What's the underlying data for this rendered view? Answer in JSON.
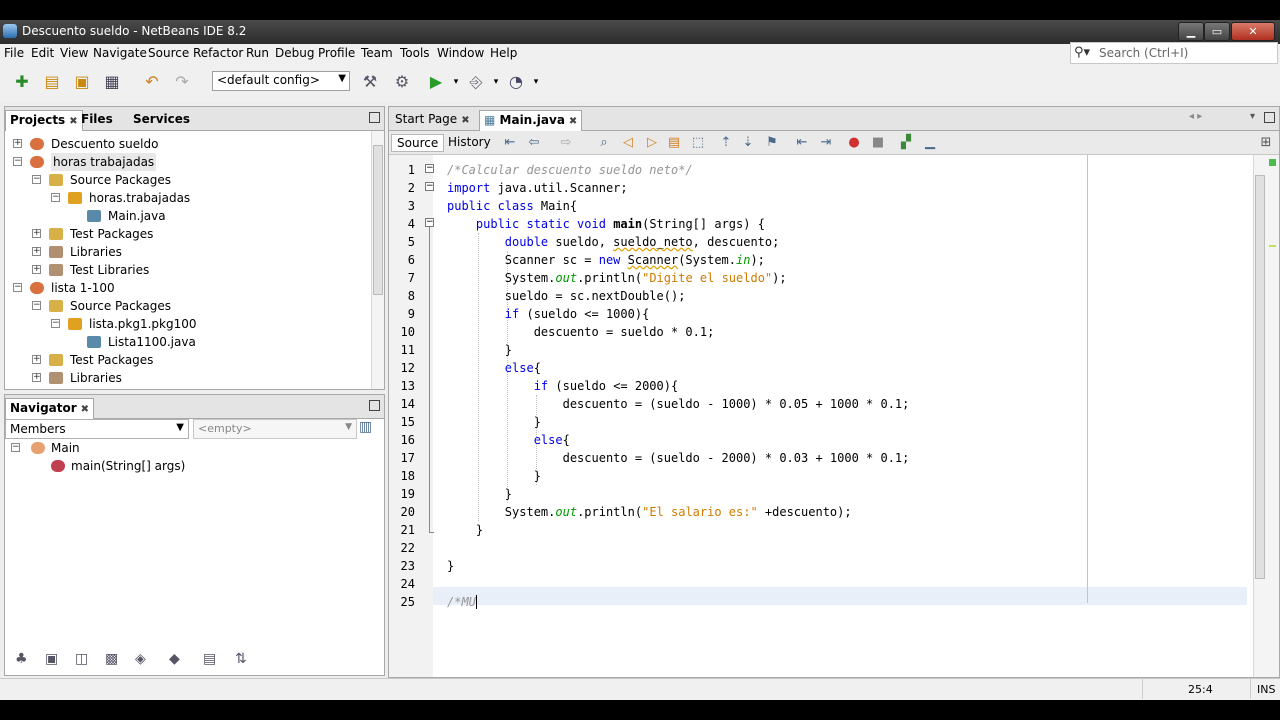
{
  "window": {
    "title": "Descuento sueldo - NetBeans IDE 8.2",
    "buttons": {
      "minimize": "▁",
      "maximize": "▭",
      "close": "✕"
    }
  },
  "menu": [
    "File",
    "Edit",
    "View",
    "Navigate",
    "Source",
    "Refactor",
    "Run",
    "Debug",
    "Profile",
    "Team",
    "Tools",
    "Window",
    "Help"
  ],
  "search": {
    "placeholder": "Search (Ctrl+I)",
    "icon": "search-icon"
  },
  "toolbar": {
    "config": "<default config>",
    "icons": [
      "new-project-icon",
      "new-file-icon",
      "open-project-icon",
      "save-all-icon",
      "undo-icon",
      "redo-icon",
      "clean-build-icon",
      "build-icon",
      "run-icon",
      "debug-icon",
      "profile-icon"
    ]
  },
  "projects_panel": {
    "tabs": [
      "Projects",
      "Files",
      "Services"
    ],
    "close_glyph": "✖",
    "tree": [
      {
        "label": "Descuento sueldo",
        "level": 0,
        "toggle": "+",
        "icon": "project"
      },
      {
        "label": "horas trabajadas",
        "level": 0,
        "toggle": "−",
        "icon": "project",
        "selected": true
      },
      {
        "label": "Source Packages",
        "level": 1,
        "toggle": "−",
        "icon": "package-folder"
      },
      {
        "label": "horas.trabajadas",
        "level": 2,
        "toggle": "−",
        "icon": "package"
      },
      {
        "label": "Main.java",
        "level": 3,
        "toggle": "",
        "icon": "java-file"
      },
      {
        "label": "Test Packages",
        "level": 1,
        "toggle": "+",
        "icon": "package-folder"
      },
      {
        "label": "Libraries",
        "level": 1,
        "toggle": "+",
        "icon": "library"
      },
      {
        "label": "Test Libraries",
        "level": 1,
        "toggle": "+",
        "icon": "library"
      },
      {
        "label": "lista 1-100",
        "level": 0,
        "toggle": "−",
        "icon": "project"
      },
      {
        "label": "Source Packages",
        "level": 1,
        "toggle": "−",
        "icon": "package-folder"
      },
      {
        "label": "lista.pkg1.pkg100",
        "level": 2,
        "toggle": "−",
        "icon": "package"
      },
      {
        "label": "Lista1100.java",
        "level": 3,
        "toggle": "",
        "icon": "java-file"
      },
      {
        "label": "Test Packages",
        "level": 1,
        "toggle": "+",
        "icon": "package-folder"
      },
      {
        "label": "Libraries",
        "level": 1,
        "toggle": "+",
        "icon": "library"
      },
      {
        "label": "Test Libraries",
        "level": 1,
        "toggle": "+",
        "icon": "library"
      }
    ]
  },
  "navigator": {
    "title": "Navigator",
    "members_select": "Members",
    "filter_select": "<empty>",
    "tree": [
      {
        "label": "Main",
        "level": 0,
        "toggle": "−"
      },
      {
        "label": "main(String[] args)",
        "level": 1,
        "toggle": ""
      }
    ]
  },
  "editor": {
    "tabs": [
      {
        "label": "Start Page"
      },
      {
        "label": "Main.java",
        "active": true
      }
    ],
    "modes": [
      "Source",
      "History"
    ],
    "lines": [
      [
        [
          "cm",
          "/*Calcular descuento sueldo neto*/"
        ]
      ],
      [
        [
          "kw",
          "import "
        ],
        [
          "",
          "java.util.Scanner;"
        ]
      ],
      [
        [
          "kw",
          "public class "
        ],
        [
          "",
          "Main{"
        ]
      ],
      [
        [
          "",
          "    "
        ],
        [
          "kw",
          "public static void "
        ],
        [
          "bold",
          "main"
        ],
        [
          "",
          "(String[] args) {"
        ]
      ],
      [
        [
          "",
          "        "
        ],
        [
          "kw",
          "double "
        ],
        [
          "",
          "sueldo, "
        ],
        [
          "err",
          "sueldo_neto"
        ],
        [
          "",
          ", descuento;"
        ]
      ],
      [
        [
          "",
          "        Scanner sc = "
        ],
        [
          "kw",
          "new "
        ],
        [
          "err",
          "Scanner"
        ],
        [
          "",
          "(System."
        ],
        [
          "fld",
          "in"
        ],
        [
          "",
          ");"
        ]
      ],
      [
        [
          "",
          "        System."
        ],
        [
          "fld",
          "out"
        ],
        [
          "",
          ".println("
        ],
        [
          "str",
          "\"Digite el sueldo\""
        ],
        [
          "",
          ");"
        ]
      ],
      [
        [
          "",
          "        sueldo = sc.nextDouble();"
        ]
      ],
      [
        [
          "",
          "        "
        ],
        [
          "kw",
          "if "
        ],
        [
          "",
          "(sueldo <= 1000){"
        ]
      ],
      [
        [
          "",
          "            descuento = sueldo * 0.1;"
        ]
      ],
      [
        [
          "",
          "        }"
        ]
      ],
      [
        [
          "",
          "        "
        ],
        [
          "kw",
          "else"
        ],
        [
          "",
          "{"
        ]
      ],
      [
        [
          "",
          "            "
        ],
        [
          "kw",
          "if "
        ],
        [
          "",
          "(sueldo <= 2000){"
        ]
      ],
      [
        [
          "",
          "                descuento = (sueldo - 1000) * 0.05 + 1000 * 0.1;"
        ]
      ],
      [
        [
          "",
          "            }"
        ]
      ],
      [
        [
          "",
          "            "
        ],
        [
          "kw",
          "else"
        ],
        [
          "",
          "{"
        ]
      ],
      [
        [
          "",
          "                descuento = (sueldo - 2000) * 0.03 + 1000 * 0.1;"
        ]
      ],
      [
        [
          "",
          "            }"
        ]
      ],
      [
        [
          "",
          "        }"
        ]
      ],
      [
        [
          "",
          "        System."
        ],
        [
          "fld",
          "out"
        ],
        [
          "",
          ".println("
        ],
        [
          "str",
          "\"El salario es:\""
        ],
        [
          "",
          " +descuento);"
        ]
      ],
      [
        [
          "",
          "    }"
        ]
      ],
      [
        [
          "",
          ""
        ]
      ],
      [
        [
          "",
          "}"
        ]
      ],
      [
        [
          "",
          ""
        ]
      ],
      [
        [
          "cm",
          "/*MU"
        ]
      ]
    ],
    "line_numbers": [
      "1",
      "2",
      "3",
      "4",
      "5",
      "6",
      "7",
      "8",
      "9",
      "10",
      "11",
      "12",
      "13",
      "14",
      "15",
      "16",
      "17",
      "18",
      "19",
      "20",
      "21",
      "22",
      "23",
      "24",
      "25"
    ]
  },
  "status": {
    "position": "25:4",
    "mode": "INS"
  }
}
